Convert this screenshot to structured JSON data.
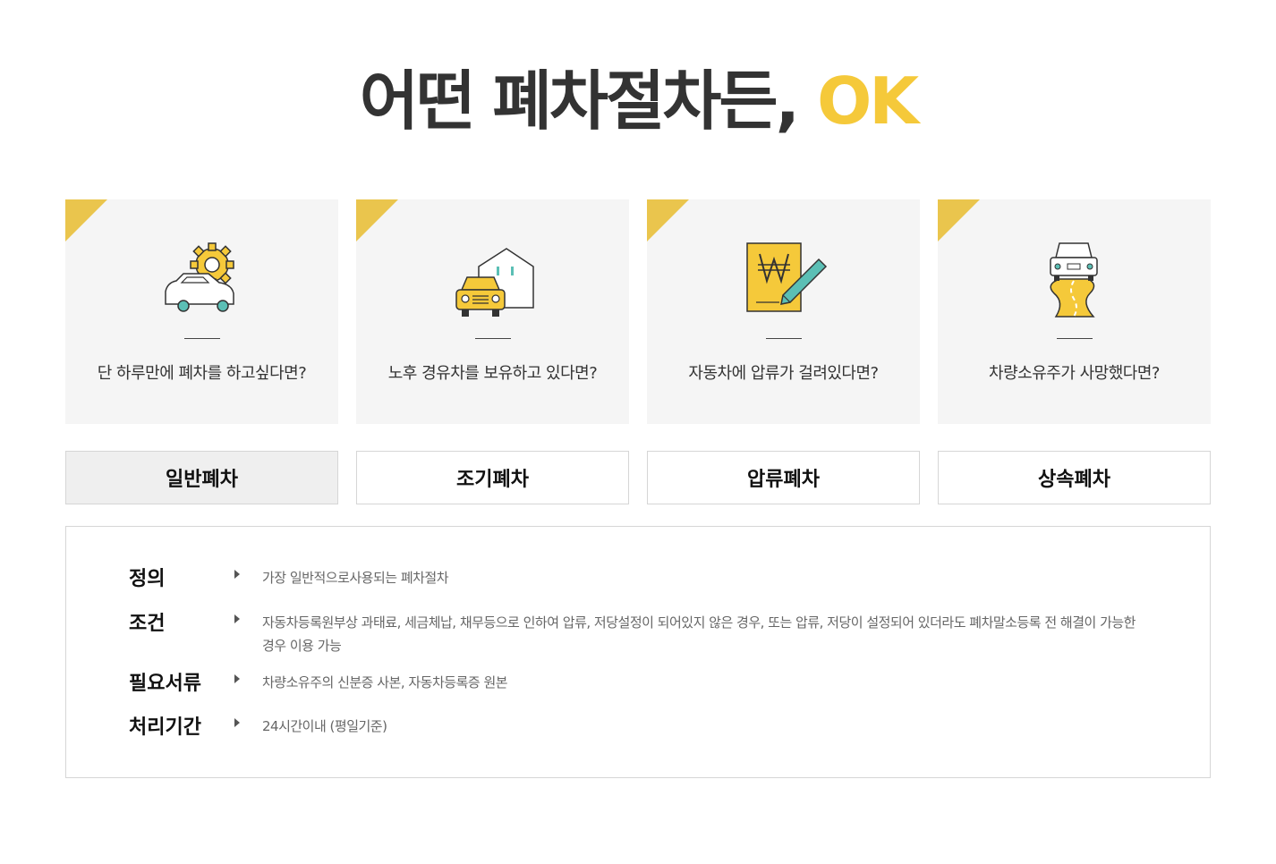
{
  "headline": {
    "main": "어떤 폐차절차든, ",
    "accent": "OK"
  },
  "colors": {
    "accent": "#f5c93a",
    "corner": "#eac54d",
    "teal": "#5bbfb5",
    "card_bg": "#f5f5f5"
  },
  "cards": [
    {
      "icon": "car-gear-icon",
      "question": "단 하루만에 폐차를 하고싶다면?"
    },
    {
      "icon": "car-house-icon",
      "question": "노후 경유차를 보유하고 있다면?"
    },
    {
      "icon": "won-document-pen-icon",
      "question": "자동차에 압류가 걸려있다면?"
    },
    {
      "icon": "car-road-icon",
      "question": "차량소유주가 사망했다면?"
    }
  ],
  "tabs": [
    "일반폐차",
    "조기폐차",
    "압류폐차",
    "상속폐차"
  ],
  "active_tab": "일반폐차",
  "details": [
    {
      "label": "정의",
      "value": "가장 일반적으로사용되는 폐차절차"
    },
    {
      "label": "조건",
      "value": "자동차등록원부상 과태료, 세금체납, 채무등으로 인하여 압류, 저당설정이 되어있지 않은 경우, 또는 압류, 저당이 설정되어 있더라도 폐차말소등록 전 해결이 가능한 경우 이용 가능"
    },
    {
      "label": "필요서류",
      "value": "차량소유주의 신분증 사본, 자동차등록증 원본"
    },
    {
      "label": "처리기간",
      "value": "24시간이내 (평일기준)"
    }
  ]
}
